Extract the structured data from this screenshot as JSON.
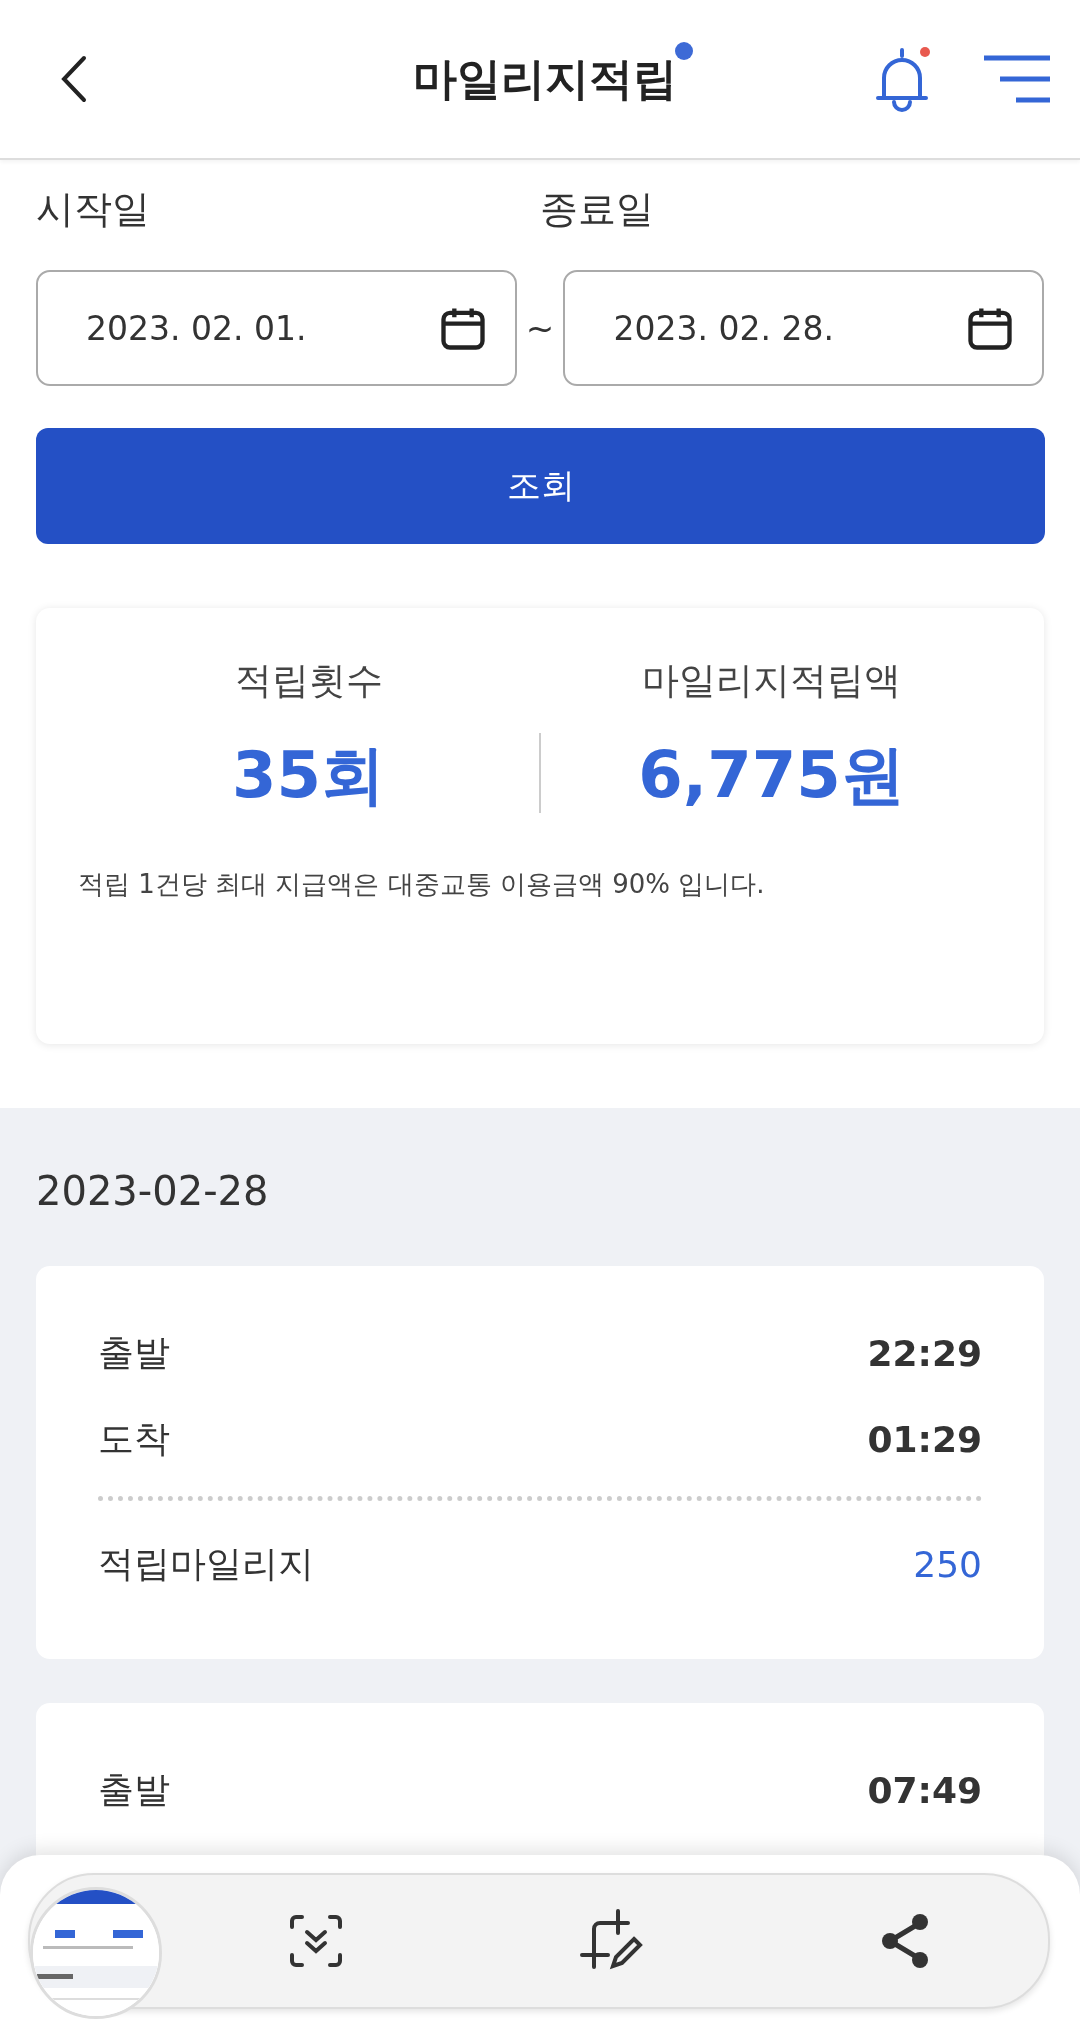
{
  "header": {
    "title": "마일리지적립",
    "title_dot": true,
    "bell_dot": true
  },
  "period": {
    "start_label": "시작일",
    "end_label": "종료일",
    "start_value": "2023. 02. 01.",
    "separator": "~",
    "end_value": "2023. 02. 28.",
    "search_button": "조회"
  },
  "summary": {
    "count_label": "적립횟수",
    "count_value": "35회",
    "amount_label": "마일리지적립액",
    "amount_value": "6,775원",
    "note": "적립 1건당 최대 지급액은 대중교통 이용금액 90% 입니다."
  },
  "history": [
    {
      "date": "2023-02-28",
      "records": [
        {
          "rows": [
            {
              "label": "출발",
              "value": "22:29"
            },
            {
              "label": "도착",
              "value": "01:29"
            }
          ],
          "mileage_label": "적립마일리지",
          "mileage_value": "250"
        },
        {
          "rows": [
            {
              "label": "출발",
              "value": "07:49"
            }
          ]
        }
      ]
    }
  ]
}
